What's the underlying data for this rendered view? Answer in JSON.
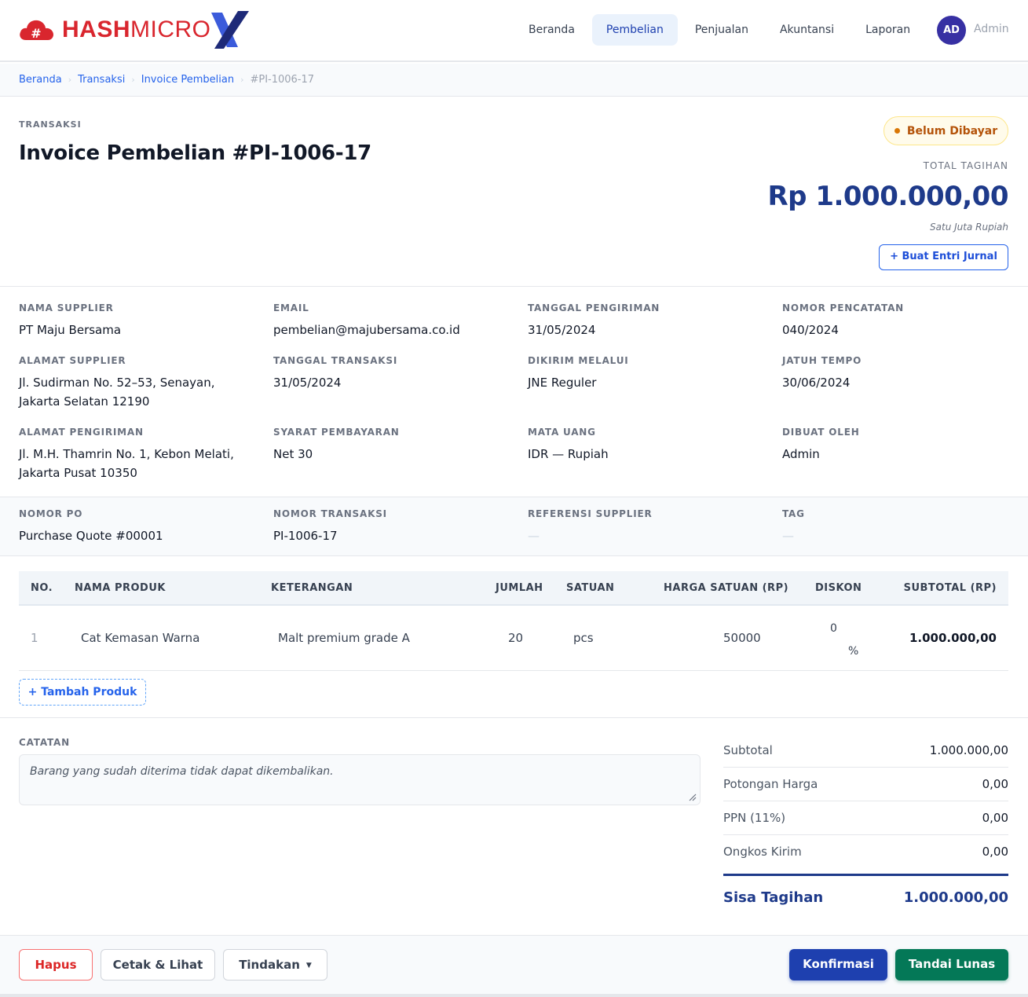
{
  "brand": {
    "name_bold": "HASH",
    "name_light": "MICRO",
    "primary_color": "#d9262e",
    "accent_color": "#2563eb"
  },
  "nav": {
    "items": [
      {
        "label": "Beranda",
        "active": false
      },
      {
        "label": "Pembelian",
        "active": true
      },
      {
        "label": "Penjualan",
        "active": false
      },
      {
        "label": "Akuntansi",
        "active": false
      },
      {
        "label": "Laporan",
        "active": false
      }
    ],
    "avatar_initials": "AD",
    "user_name": "Admin"
  },
  "breadcrumb": [
    "Beranda",
    "Transaksi",
    "Invoice Pembelian",
    "#PI-1006-17"
  ],
  "header": {
    "eyebrow": "TRANSAKSI",
    "title": "Invoice Pembelian #PI-1006-17",
    "status": "Belum Dibayar",
    "status_color": "#b45309",
    "total_label": "TOTAL TAGIHAN",
    "total_amount": "Rp 1.000.000,00",
    "total_words": "Satu Juta Rupiah",
    "journal_button": "+ Buat Entri Jurnal"
  },
  "info": {
    "supplier_name_label": "NAMA SUPPLIER",
    "supplier_name": "PT Maju Bersama",
    "email_label": "EMAIL",
    "email": "pembelian@majubersama.co.id",
    "ship_date_label": "TANGGAL PENGIRIMAN",
    "ship_date": "31/05/2024",
    "record_no_label": "NOMOR PENCATATAN",
    "record_no": "040/2024",
    "supplier_address_label": "ALAMAT SUPPLIER",
    "supplier_address_1": "Jl. Sudirman No. 52–53, Senayan,",
    "supplier_address_2": "Jakarta Selatan 12190",
    "trx_date_label": "TANGGAL TRANSAKSI",
    "trx_date": "31/05/2024",
    "shipped_via_label": "DIKIRIM MELALUI",
    "shipped_via": "JNE Reguler",
    "due_date_label": "JATUH TEMPO",
    "due_date": "30/06/2024",
    "ship_address_label": "ALAMAT PENGIRIMAN",
    "ship_address_1": "Jl. M.H. Thamrin No. 1, Kebon Melati,",
    "ship_address_2": "Jakarta Pusat 10350",
    "payment_terms_label": "SYARAT PEMBAYARAN",
    "payment_terms": "Net 30",
    "currency_label": "MATA UANG",
    "currency": "IDR — Rupiah",
    "created_by_label": "DIBUAT OLEH",
    "created_by": "Admin"
  },
  "po": {
    "po_no_label": "NOMOR PO",
    "po_no": "Purchase Quote #00001",
    "trx_no_label": "NOMOR TRANSAKSI",
    "trx_no": "PI-1006-17",
    "supplier_ref_label": "REFERENSI SUPPLIER",
    "supplier_ref": "—",
    "tag_label": "TAG",
    "tag": "—"
  },
  "table": {
    "headers": {
      "no": "NO.",
      "product": "NAMA PRODUK",
      "description": "KETERANGAN",
      "qty": "JUMLAH",
      "unit": "SATUAN",
      "price": "HARGA SATUAN (RP)",
      "discount": "DISKON",
      "subtotal": "SUBTOTAL (RP)"
    },
    "rows": [
      {
        "no": "1",
        "product": "Cat Kemasan Warna",
        "description": "Malt premium grade A",
        "qty": "20",
        "unit": "pcs",
        "price": "50000",
        "discount": "0",
        "discount_unit": "%",
        "subtotal": "1.000.000,00"
      }
    ],
    "add_product": "+ Tambah Produk"
  },
  "notes": {
    "label": "CATATAN",
    "text": "Barang yang sudah diterima tidak dapat dikembalikan."
  },
  "summary": {
    "rows": [
      {
        "label": "Subtotal",
        "value": "1.000.000,00"
      },
      {
        "label": "Potongan Harga",
        "value": "0,00"
      },
      {
        "label": "PPN (11%)",
        "value": "0,00"
      },
      {
        "label": "Ongkos Kirim",
        "value": "0,00"
      }
    ],
    "total_label": "Sisa Tagihan",
    "total_value": "1.000.000,00"
  },
  "footer": {
    "delete": "Hapus",
    "print": "Cetak & Lihat",
    "actions": "Tindakan",
    "confirm": "Konfirmasi",
    "mark_paid": "Tandai Lunas"
  }
}
